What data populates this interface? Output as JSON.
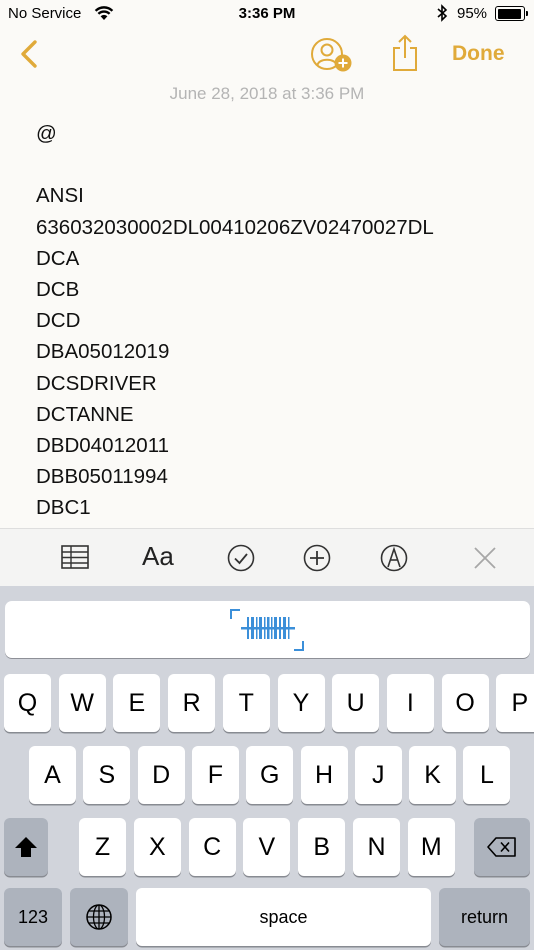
{
  "status_bar": {
    "carrier": "No Service",
    "time": "3:36 PM",
    "battery_percent": "95%",
    "battery_level": 0.95
  },
  "nav": {
    "done_label": "Done",
    "accent_color": "#e0aa3a"
  },
  "note": {
    "date": "June 28, 2018 at 3:36 PM",
    "lines": [
      "@",
      "",
      "ANSI",
      "636032030002DL00410206ZV02470027DL",
      "DCA",
      "DCB",
      "DCD",
      "DBA05012019",
      "DCSDRIVER",
      "DCTANNE",
      "DBD04012011",
      "DBB05011994",
      "DBC1"
    ]
  },
  "keyboard": {
    "row1": [
      "Q",
      "W",
      "E",
      "R",
      "T",
      "Y",
      "U",
      "I",
      "O",
      "P"
    ],
    "row2": [
      "A",
      "S",
      "D",
      "F",
      "G",
      "H",
      "J",
      "K",
      "L"
    ],
    "row3": [
      "Z",
      "X",
      "C",
      "V",
      "B",
      "N",
      "M"
    ],
    "numbers_label": "123",
    "space_label": "space",
    "return_label": "return"
  }
}
